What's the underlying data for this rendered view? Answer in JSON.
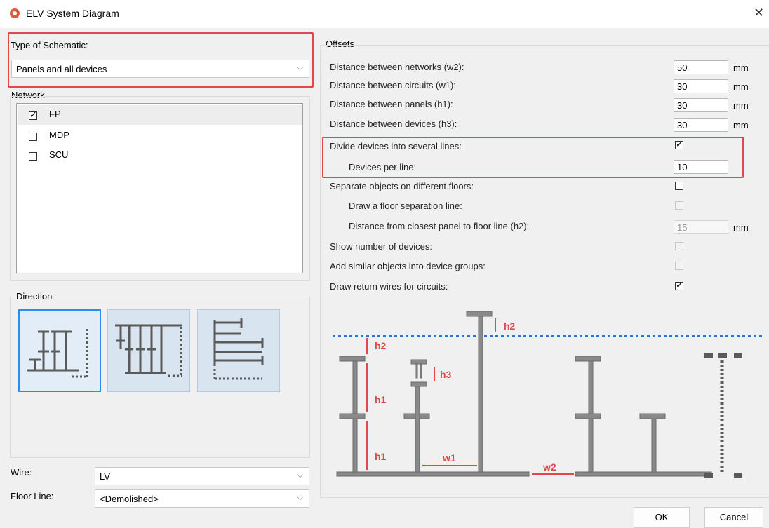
{
  "window": {
    "title": "ELV System Diagram",
    "close_glyph": "✕"
  },
  "schematic": {
    "label": "Type of Schematic:",
    "value": "Panels and all devices"
  },
  "network": {
    "label": "Network",
    "items": [
      {
        "label": "FP",
        "checked": true
      },
      {
        "label": "MDP",
        "checked": false
      },
      {
        "label": "SCU",
        "checked": false
      }
    ]
  },
  "direction": {
    "label": "Direction",
    "selected_index": 0
  },
  "wire": {
    "label": "Wire:",
    "value": "LV"
  },
  "floor_line": {
    "label": "Floor Line:",
    "value": "<Demolished>"
  },
  "offsets": {
    "label": "Offsets",
    "unit": "mm",
    "rows": [
      {
        "label": "Distance between networks (w2):",
        "value": "50"
      },
      {
        "label": "Distance between circuits (w1):",
        "value": "30"
      },
      {
        "label": "Distance between panels (h1):",
        "value": "30"
      },
      {
        "label": "Distance between devices (h3):",
        "value": "30"
      }
    ],
    "divide_devices": {
      "label": "Divide devices into several lines:",
      "checked": true
    },
    "devices_per_line": {
      "label": "Devices per line:",
      "value": "10"
    },
    "separate_floors": {
      "label": "Separate objects on different floors:",
      "checked": false
    },
    "draw_floor_line": {
      "label": "Draw a floor separation line:",
      "checked": false
    },
    "floor_distance": {
      "label": "Distance from closest panel to floor line (h2):",
      "value": "15"
    },
    "show_number": {
      "label": "Show number of devices:",
      "checked": false
    },
    "add_similar": {
      "label": "Add similar objects into device groups:",
      "checked": false
    },
    "return_wires": {
      "label": "Draw return wires for circuits:",
      "checked": true
    }
  },
  "diagram": {
    "h1": "h1",
    "h2": "h2",
    "h3": "h3",
    "w1": "w1",
    "w2": "w2"
  },
  "buttons": {
    "ok": "OK",
    "cancel": "Cancel"
  },
  "colors": {
    "accent_red": "#e0484a",
    "selection_blue": "#2d8cf0",
    "diagram_dashed": "#2d74c4",
    "diagram_bar": "#7d7d7d"
  }
}
